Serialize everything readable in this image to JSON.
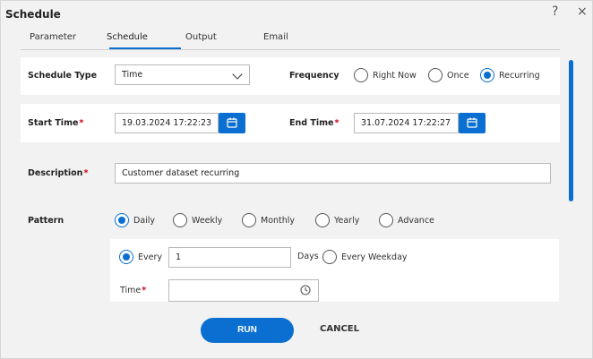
{
  "window": {
    "title": "Schedule",
    "help_glyph": "?",
    "close_glyph": "×"
  },
  "tabs": [
    {
      "label": "Parameter"
    },
    {
      "label": "Schedule"
    },
    {
      "label": "Output"
    },
    {
      "label": "Email"
    }
  ],
  "schedule_type": {
    "label": "Schedule Type",
    "value": "Time"
  },
  "frequency": {
    "label": "Frequency",
    "options": [
      "Right Now",
      "Once",
      "Recurring"
    ],
    "selected": "Recurring"
  },
  "start_time": {
    "label": "Start Time",
    "required": "*",
    "value": "19.03.2024 17:22:23"
  },
  "end_time": {
    "label": "End Time",
    "required": "*",
    "value": "31.07.2024 17:22:27"
  },
  "description": {
    "label": "Description",
    "required": "*",
    "value": "Customer dataset recurring"
  },
  "pattern": {
    "label": "Pattern",
    "options": [
      "Daily",
      "Weekly",
      "Monthly",
      "Yearly",
      "Advance"
    ],
    "selected": "Daily"
  },
  "daily": {
    "every_label": "Every",
    "every_value": "1",
    "unit": "Days",
    "weekday_label": "Every Weekday",
    "time_label": "Time",
    "time_required": "*",
    "time_value": ""
  },
  "footer": {
    "run_label": "RUN",
    "cancel_label": "CANCEL"
  },
  "colors": {
    "accent": "#0a6fd1",
    "required": "#d0021b"
  }
}
